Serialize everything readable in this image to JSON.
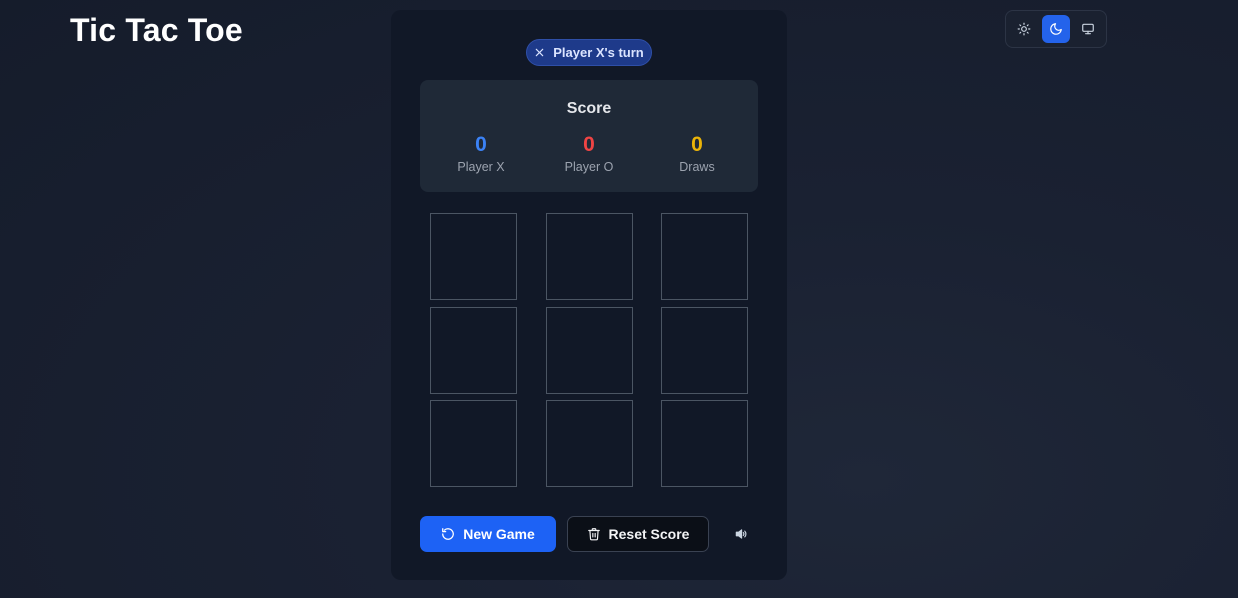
{
  "header": {
    "title": "Tic Tac Toe"
  },
  "theme": {
    "options": [
      {
        "name": "light",
        "icon": "sun-icon"
      },
      {
        "name": "dark",
        "icon": "moon-icon",
        "active": true
      },
      {
        "name": "system",
        "icon": "monitor-icon"
      }
    ],
    "accent": "#2463eb"
  },
  "game": {
    "turn_label": "Player X's turn",
    "turn_icon": "x-icon"
  },
  "score": {
    "title": "Score",
    "player_x": {
      "value": "0",
      "label": "Player X",
      "color": "#3b82f6"
    },
    "player_o": {
      "value": "0",
      "label": "Player O",
      "color": "#ef4444"
    },
    "draws": {
      "value": "0",
      "label": "Draws",
      "color": "#eab308"
    }
  },
  "board": {
    "cells": [
      "",
      "",
      "",
      "",
      "",
      "",
      "",
      "",
      ""
    ]
  },
  "actions": {
    "new_game_label": "New Game",
    "new_game_icon": "rotate-ccw-icon",
    "reset_score_label": "Reset Score",
    "reset_score_icon": "trash-icon",
    "sound_icon": "speaker-icon"
  }
}
